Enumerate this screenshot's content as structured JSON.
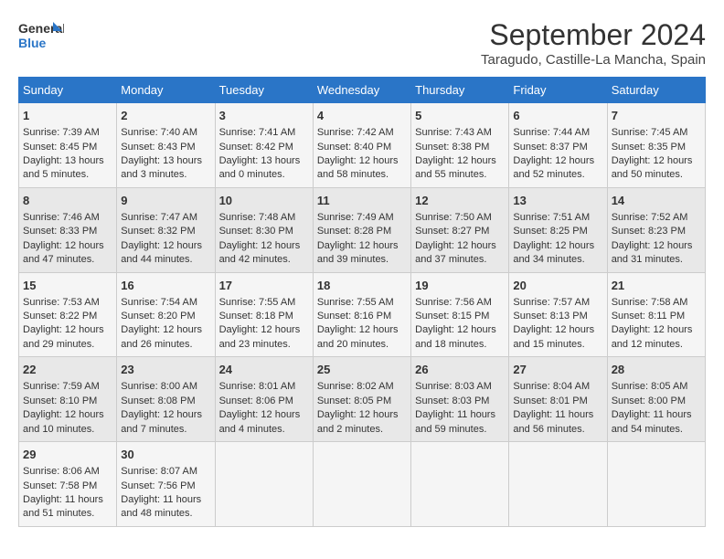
{
  "logo": {
    "line1": "General",
    "line2": "Blue"
  },
  "title": "September 2024",
  "location": "Taragudo, Castille-La Mancha, Spain",
  "weekdays": [
    "Sunday",
    "Monday",
    "Tuesday",
    "Wednesday",
    "Thursday",
    "Friday",
    "Saturday"
  ],
  "weeks": [
    [
      {
        "day": "1",
        "lines": [
          "Sunrise: 7:39 AM",
          "Sunset: 8:45 PM",
          "Daylight: 13 hours",
          "and 5 minutes."
        ]
      },
      {
        "day": "2",
        "lines": [
          "Sunrise: 7:40 AM",
          "Sunset: 8:43 PM",
          "Daylight: 13 hours",
          "and 3 minutes."
        ]
      },
      {
        "day": "3",
        "lines": [
          "Sunrise: 7:41 AM",
          "Sunset: 8:42 PM",
          "Daylight: 13 hours",
          "and 0 minutes."
        ]
      },
      {
        "day": "4",
        "lines": [
          "Sunrise: 7:42 AM",
          "Sunset: 8:40 PM",
          "Daylight: 12 hours",
          "and 58 minutes."
        ]
      },
      {
        "day": "5",
        "lines": [
          "Sunrise: 7:43 AM",
          "Sunset: 8:38 PM",
          "Daylight: 12 hours",
          "and 55 minutes."
        ]
      },
      {
        "day": "6",
        "lines": [
          "Sunrise: 7:44 AM",
          "Sunset: 8:37 PM",
          "Daylight: 12 hours",
          "and 52 minutes."
        ]
      },
      {
        "day": "7",
        "lines": [
          "Sunrise: 7:45 AM",
          "Sunset: 8:35 PM",
          "Daylight: 12 hours",
          "and 50 minutes."
        ]
      }
    ],
    [
      {
        "day": "8",
        "lines": [
          "Sunrise: 7:46 AM",
          "Sunset: 8:33 PM",
          "Daylight: 12 hours",
          "and 47 minutes."
        ]
      },
      {
        "day": "9",
        "lines": [
          "Sunrise: 7:47 AM",
          "Sunset: 8:32 PM",
          "Daylight: 12 hours",
          "and 44 minutes."
        ]
      },
      {
        "day": "10",
        "lines": [
          "Sunrise: 7:48 AM",
          "Sunset: 8:30 PM",
          "Daylight: 12 hours",
          "and 42 minutes."
        ]
      },
      {
        "day": "11",
        "lines": [
          "Sunrise: 7:49 AM",
          "Sunset: 8:28 PM",
          "Daylight: 12 hours",
          "and 39 minutes."
        ]
      },
      {
        "day": "12",
        "lines": [
          "Sunrise: 7:50 AM",
          "Sunset: 8:27 PM",
          "Daylight: 12 hours",
          "and 37 minutes."
        ]
      },
      {
        "day": "13",
        "lines": [
          "Sunrise: 7:51 AM",
          "Sunset: 8:25 PM",
          "Daylight: 12 hours",
          "and 34 minutes."
        ]
      },
      {
        "day": "14",
        "lines": [
          "Sunrise: 7:52 AM",
          "Sunset: 8:23 PM",
          "Daylight: 12 hours",
          "and 31 minutes."
        ]
      }
    ],
    [
      {
        "day": "15",
        "lines": [
          "Sunrise: 7:53 AM",
          "Sunset: 8:22 PM",
          "Daylight: 12 hours",
          "and 29 minutes."
        ]
      },
      {
        "day": "16",
        "lines": [
          "Sunrise: 7:54 AM",
          "Sunset: 8:20 PM",
          "Daylight: 12 hours",
          "and 26 minutes."
        ]
      },
      {
        "day": "17",
        "lines": [
          "Sunrise: 7:55 AM",
          "Sunset: 8:18 PM",
          "Daylight: 12 hours",
          "and 23 minutes."
        ]
      },
      {
        "day": "18",
        "lines": [
          "Sunrise: 7:55 AM",
          "Sunset: 8:16 PM",
          "Daylight: 12 hours",
          "and 20 minutes."
        ]
      },
      {
        "day": "19",
        "lines": [
          "Sunrise: 7:56 AM",
          "Sunset: 8:15 PM",
          "Daylight: 12 hours",
          "and 18 minutes."
        ]
      },
      {
        "day": "20",
        "lines": [
          "Sunrise: 7:57 AM",
          "Sunset: 8:13 PM",
          "Daylight: 12 hours",
          "and 15 minutes."
        ]
      },
      {
        "day": "21",
        "lines": [
          "Sunrise: 7:58 AM",
          "Sunset: 8:11 PM",
          "Daylight: 12 hours",
          "and 12 minutes."
        ]
      }
    ],
    [
      {
        "day": "22",
        "lines": [
          "Sunrise: 7:59 AM",
          "Sunset: 8:10 PM",
          "Daylight: 12 hours",
          "and 10 minutes."
        ]
      },
      {
        "day": "23",
        "lines": [
          "Sunrise: 8:00 AM",
          "Sunset: 8:08 PM",
          "Daylight: 12 hours",
          "and 7 minutes."
        ]
      },
      {
        "day": "24",
        "lines": [
          "Sunrise: 8:01 AM",
          "Sunset: 8:06 PM",
          "Daylight: 12 hours",
          "and 4 minutes."
        ]
      },
      {
        "day": "25",
        "lines": [
          "Sunrise: 8:02 AM",
          "Sunset: 8:05 PM",
          "Daylight: 12 hours",
          "and 2 minutes."
        ]
      },
      {
        "day": "26",
        "lines": [
          "Sunrise: 8:03 AM",
          "Sunset: 8:03 PM",
          "Daylight: 11 hours",
          "and 59 minutes."
        ]
      },
      {
        "day": "27",
        "lines": [
          "Sunrise: 8:04 AM",
          "Sunset: 8:01 PM",
          "Daylight: 11 hours",
          "and 56 minutes."
        ]
      },
      {
        "day": "28",
        "lines": [
          "Sunrise: 8:05 AM",
          "Sunset: 8:00 PM",
          "Daylight: 11 hours",
          "and 54 minutes."
        ]
      }
    ],
    [
      {
        "day": "29",
        "lines": [
          "Sunrise: 8:06 AM",
          "Sunset: 7:58 PM",
          "Daylight: 11 hours",
          "and 51 minutes."
        ]
      },
      {
        "day": "30",
        "lines": [
          "Sunrise: 8:07 AM",
          "Sunset: 7:56 PM",
          "Daylight: 11 hours",
          "and 48 minutes."
        ]
      },
      {
        "day": "",
        "lines": []
      },
      {
        "day": "",
        "lines": []
      },
      {
        "day": "",
        "lines": []
      },
      {
        "day": "",
        "lines": []
      },
      {
        "day": "",
        "lines": []
      }
    ]
  ]
}
